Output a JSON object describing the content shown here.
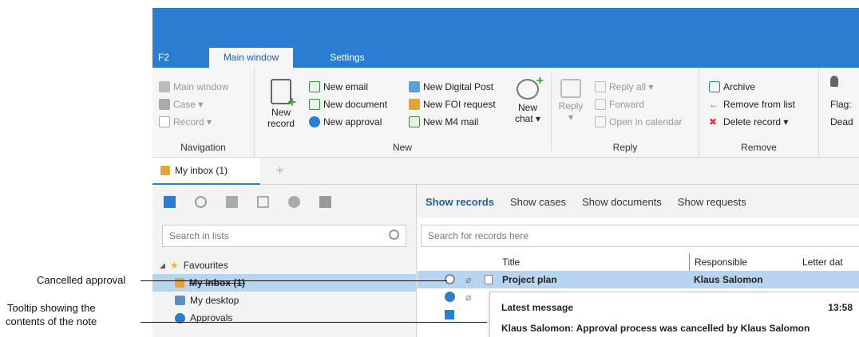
{
  "ribbon_tabs": {
    "f2": "F2",
    "main": "Main window",
    "settings": "Settings"
  },
  "ribbon": {
    "navigation": {
      "label": "Navigation",
      "items": [
        "Main window",
        "Case ▾",
        "Record ▾"
      ]
    },
    "new": {
      "label": "New",
      "new_record": "New\nrecord",
      "new_record_line1": "New",
      "new_record_line2": "record",
      "items_col1": [
        "New email",
        "New document",
        "New approval"
      ],
      "items_col2": [
        "New Digital Post",
        "New FOI request",
        "New M4 mail"
      ],
      "new_chat_line1": "New",
      "new_chat_line2": "chat ▾"
    },
    "reply": {
      "label": "Reply",
      "reply_line1": "Reply",
      "reply_line2": "▾",
      "items": [
        "Reply all ▾",
        "Forward",
        "Open in calendar"
      ]
    },
    "remove": {
      "label": "Remove",
      "items": [
        "Archive",
        "Remove from list",
        "Delete record ▾"
      ]
    },
    "flag": {
      "flag_label": "Flag:",
      "dead_label": "Dead"
    }
  },
  "tabs": {
    "inbox": "My inbox (1)",
    "add": "+"
  },
  "left": {
    "search_placeholder": "Search in lists",
    "tree": {
      "favourites": "Favourites",
      "items": [
        "My inbox (1)",
        "My desktop",
        "Approvals"
      ]
    }
  },
  "right": {
    "show": [
      "Show records",
      "Show cases",
      "Show documents",
      "Show requests"
    ],
    "search_placeholder": "Search for records here",
    "columns": {
      "title": "Title",
      "responsible": "Responsible",
      "letter_date": "Letter dat"
    },
    "row": {
      "title": "Project plan",
      "responsible": "Klaus Salomon"
    },
    "tooltip": {
      "title": "Latest message",
      "time": "13:58",
      "body": "Klaus Salomon: Approval process was cancelled by Klaus Salomon"
    }
  },
  "callouts": {
    "cancelled": "Cancelled approval",
    "tooltip_line1": "Tooltip showing the",
    "tooltip_line2": "contents of the note"
  },
  "colors": {
    "accent": "#2b7dd1",
    "selection": "#b7d4f1"
  }
}
